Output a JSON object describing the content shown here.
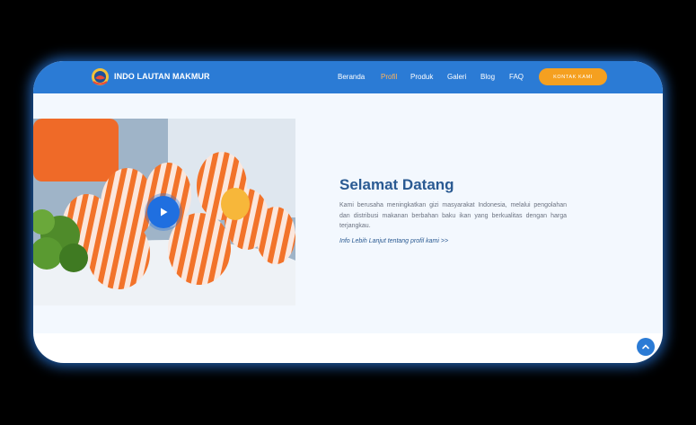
{
  "header": {
    "brand": "INDO LAUTAN MAKMUR",
    "logo_icon": "indo-lautan-makmur-logo",
    "nav": [
      {
        "label": "Beranda",
        "active": false
      },
      {
        "label": "Profil",
        "active": true
      },
      {
        "label": "Produk",
        "active": false
      },
      {
        "label": "Galeri",
        "active": false
      },
      {
        "label": "Blog",
        "active": false
      },
      {
        "label": "FAQ",
        "active": false
      }
    ],
    "cta_label": "KONTAK KAMI"
  },
  "welcome": {
    "title": "Selamat Datang",
    "description": "Kami berusaha meningkatkan gizi masyarakat Indonesia, melalui pengolahan dan distribusi makanan berbahan baku ikan yang berkualitas dengan harga terjangkau.",
    "link_label": "Info Lebih Lanjut tentang profil kami >>"
  },
  "media": {
    "play_icon": "play-icon",
    "scroll_top_icon": "chevron-up-icon"
  },
  "colors": {
    "primary": "#2b7bd5",
    "accent": "#f5a020",
    "heading": "#2a5a92",
    "background": "#f3f8fe"
  }
}
